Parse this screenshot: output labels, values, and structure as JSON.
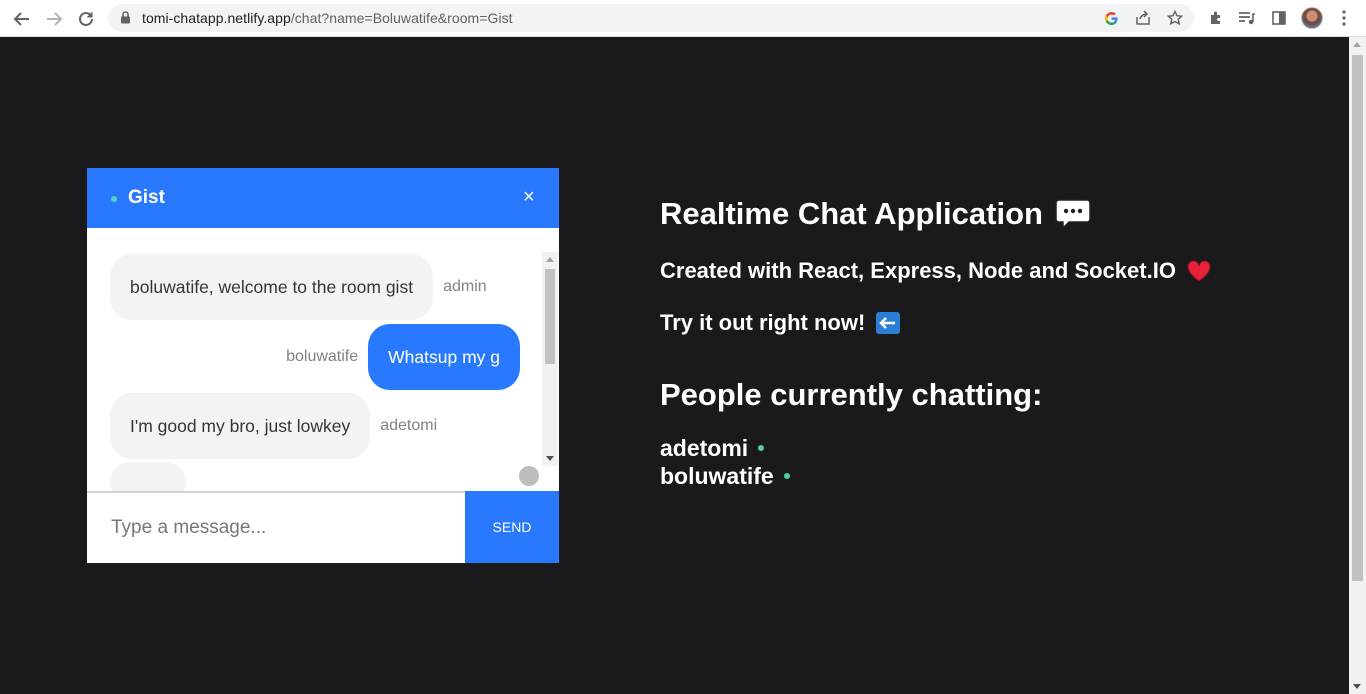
{
  "browser": {
    "url_host": "tomi-chatapp.netlify.app",
    "url_path": "/chat?name=Boluwatife&room=Gist"
  },
  "chat": {
    "room_name": "Gist",
    "close_glyph": "×",
    "messages": [
      {
        "text": "boluwatife, welcome to the room gist",
        "sender": "admin",
        "mine": false
      },
      {
        "text": "Whatsup my g",
        "sender": "boluwatife",
        "mine": true
      },
      {
        "text": "I'm good my bro, just lowkey",
        "sender": "adetomi",
        "mine": false
      }
    ],
    "input_placeholder": "Type a message...",
    "send_label": "SEND"
  },
  "info": {
    "title": "Realtime Chat Application",
    "created_with": "Created with React, Express, Node and Socket.IO",
    "try_it": "Try it out right now!",
    "people_heading": "People currently chatting:",
    "people": [
      "adetomi",
      "boluwatife"
    ]
  },
  "colors": {
    "accent": "#2979ff",
    "online_dot": "#4cd3a0",
    "page_bg": "#1a1a1d"
  }
}
